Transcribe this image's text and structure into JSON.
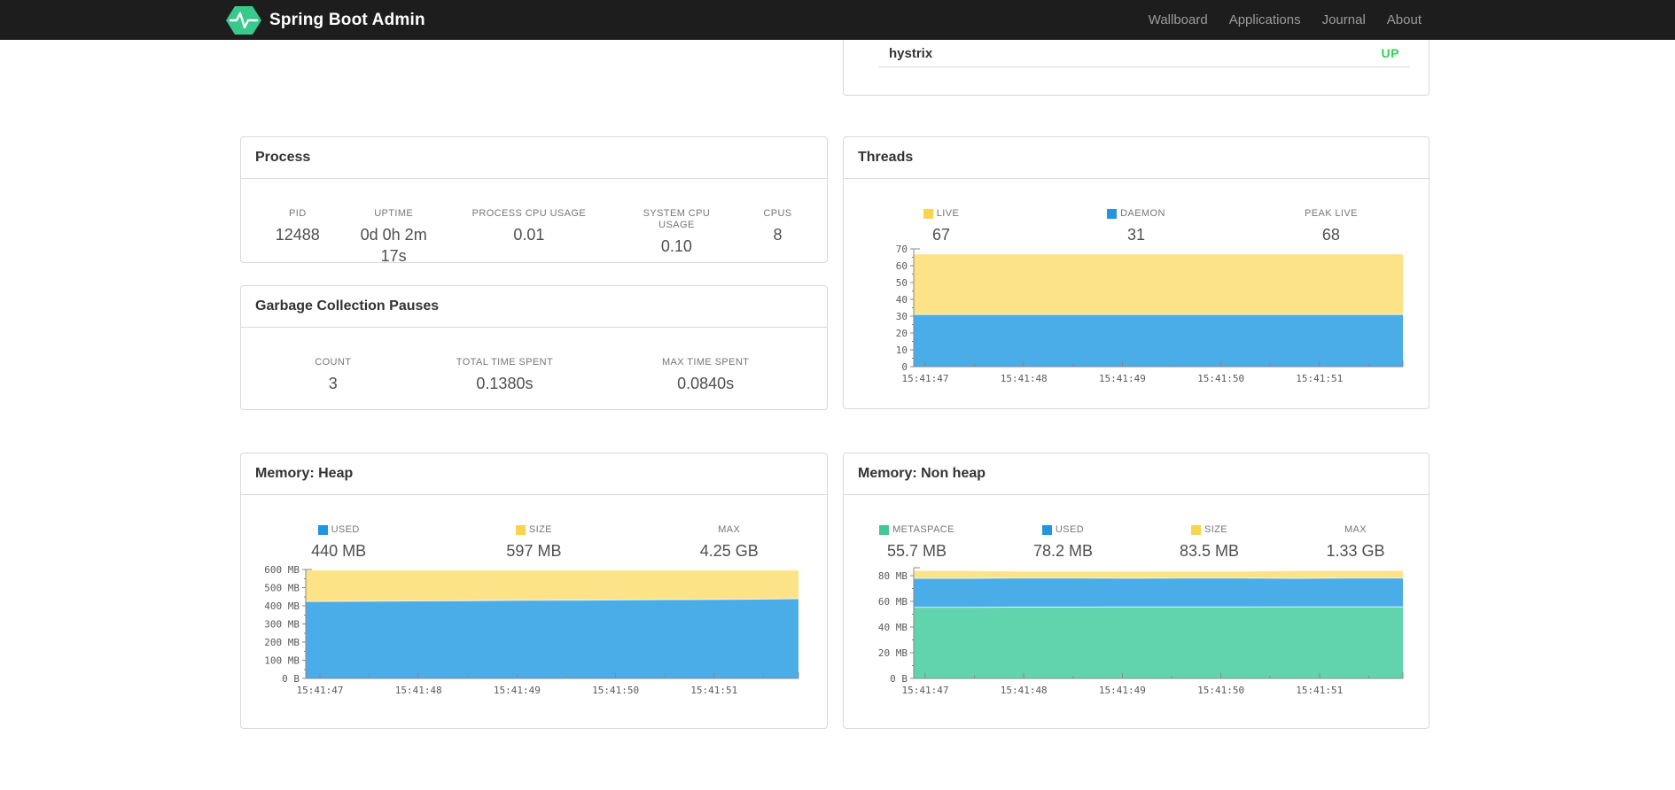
{
  "navbar": {
    "brand": "Spring Boot Admin",
    "logo_color": "#38c98c",
    "links": [
      {
        "label": "Wallboard"
      },
      {
        "label": "Applications"
      },
      {
        "label": "Journal"
      },
      {
        "label": "About"
      }
    ]
  },
  "health_panel": {
    "service": "hystrix",
    "status": "UP",
    "status_color": "#32d156"
  },
  "process_panel": {
    "title": "Process",
    "stats": [
      {
        "label": "PID",
        "value": "12488"
      },
      {
        "label": "UPTIME",
        "value": "0d 0h 2m 17s"
      },
      {
        "label": "PROCESS CPU USAGE",
        "value": "0.01"
      },
      {
        "label": "SYSTEM CPU USAGE",
        "value": "0.10"
      },
      {
        "label": "CPUS",
        "value": "8"
      }
    ]
  },
  "gc_panel": {
    "title": "Garbage Collection Pauses",
    "stats": [
      {
        "label": "COUNT",
        "value": "3"
      },
      {
        "label": "TOTAL TIME SPENT",
        "value": "0.1380s"
      },
      {
        "label": "MAX TIME SPENT",
        "value": "0.0840s"
      }
    ]
  },
  "threads_panel": {
    "title": "Threads",
    "stats": [
      {
        "label": "LIVE",
        "value": "67",
        "color": "#fbd34d"
      },
      {
        "label": "DAEMON",
        "value": "31",
        "color": "#2095e0"
      },
      {
        "label": "PEAK LIVE",
        "value": "68"
      }
    ]
  },
  "heap_panel": {
    "title": "Memory: Heap",
    "stats": [
      {
        "label": "USED",
        "value": "440 MB",
        "color": "#2095e0"
      },
      {
        "label": "SIZE",
        "value": "597 MB",
        "color": "#fbd34d"
      },
      {
        "label": "MAX",
        "value": "4.25 GB"
      }
    ]
  },
  "nonheap_panel": {
    "title": "Memory: Non heap",
    "stats": [
      {
        "label": "METASPACE",
        "value": "55.7 MB",
        "color": "#45c795"
      },
      {
        "label": "USED",
        "value": "78.2 MB",
        "color": "#2095e0"
      },
      {
        "label": "SIZE",
        "value": "83.5 MB",
        "color": "#fbd34d"
      },
      {
        "label": "MAX",
        "value": "1.33 GB"
      }
    ]
  },
  "chart_data": [
    {
      "id": "threads",
      "type": "area",
      "stacked": true,
      "title": "Threads",
      "x_tick_labels": [
        "15:41:47",
        "15:41:48",
        "15:41:49",
        "15:41:50",
        "15:41:51"
      ],
      "ylim": [
        0,
        70
      ],
      "yticks": [
        {
          "v": 0,
          "label": "0"
        },
        {
          "v": 10,
          "label": "10"
        },
        {
          "v": 20,
          "label": "20"
        },
        {
          "v": 30,
          "label": "30"
        },
        {
          "v": 40,
          "label": "40"
        },
        {
          "v": 50,
          "label": "50"
        },
        {
          "v": 60,
          "label": "60"
        },
        {
          "v": 70,
          "label": "70"
        }
      ],
      "series": [
        {
          "name": "LIVE",
          "color": "#fde387",
          "values": [
            67,
            67,
            67,
            67,
            67,
            67,
            67,
            67,
            67,
            67
          ]
        },
        {
          "name": "DAEMON",
          "color": "#4bade8",
          "values": [
            31,
            31,
            31,
            31,
            31,
            31,
            31,
            31,
            31,
            31
          ]
        }
      ],
      "legend_position": "top",
      "grid": false
    },
    {
      "id": "heap",
      "type": "area",
      "stacked": true,
      "title": "Memory: Heap",
      "x_tick_labels": [
        "15:41:47",
        "15:41:48",
        "15:41:49",
        "15:41:50",
        "15:41:51"
      ],
      "ylim": [
        0,
        600
      ],
      "yticks": [
        {
          "v": 0,
          "label": "0 B"
        },
        {
          "v": 100,
          "label": "100 MB"
        },
        {
          "v": 200,
          "label": "200 MB"
        },
        {
          "v": 300,
          "label": "300 MB"
        },
        {
          "v": 400,
          "label": "400 MB"
        },
        {
          "v": 500,
          "label": "500 MB"
        },
        {
          "v": 600,
          "label": "600 MB"
        }
      ],
      "series": [
        {
          "name": "SIZE",
          "color": "#fde387",
          "values": [
            597,
            597,
            597,
            597,
            597,
            597,
            597,
            597,
            597,
            597
          ]
        },
        {
          "name": "USED",
          "color": "#4bade8",
          "values": [
            424,
            425,
            427,
            428,
            430,
            431,
            433,
            434,
            436,
            439
          ]
        }
      ],
      "legend_position": "top",
      "grid": false
    },
    {
      "id": "nonheap",
      "type": "area",
      "stacked": true,
      "title": "Memory: Non heap",
      "x_tick_labels": [
        "15:41:47",
        "15:41:48",
        "15:41:49",
        "15:41:50",
        "15:41:51"
      ],
      "ylim": [
        0,
        86.2
      ],
      "yticks": [
        {
          "v": 0,
          "label": "0 B"
        },
        {
          "v": 20,
          "label": "20 MB"
        },
        {
          "v": 40,
          "label": "40 MB"
        },
        {
          "v": 60,
          "label": "60 MB"
        },
        {
          "v": 80,
          "label": "80 MB"
        }
      ],
      "series": [
        {
          "name": "SIZE",
          "color": "#fde387",
          "values": [
            83.9,
            83.9,
            83.5,
            83.5,
            83.5,
            83.5,
            83.5,
            83.9,
            83.9,
            83.9
          ]
        },
        {
          "name": "USED",
          "color": "#4bade8",
          "values": [
            77.9,
            77.9,
            78.2,
            78.2,
            78.0,
            78.2,
            78.2,
            77.9,
            78.2,
            78.2
          ]
        },
        {
          "name": "METASPACE",
          "color": "#62d4ad",
          "values": [
            55.4,
            55.4,
            55.5,
            55.5,
            55.6,
            55.6,
            55.6,
            55.7,
            55.7,
            55.7
          ]
        }
      ],
      "legend_position": "top",
      "grid": false
    }
  ]
}
